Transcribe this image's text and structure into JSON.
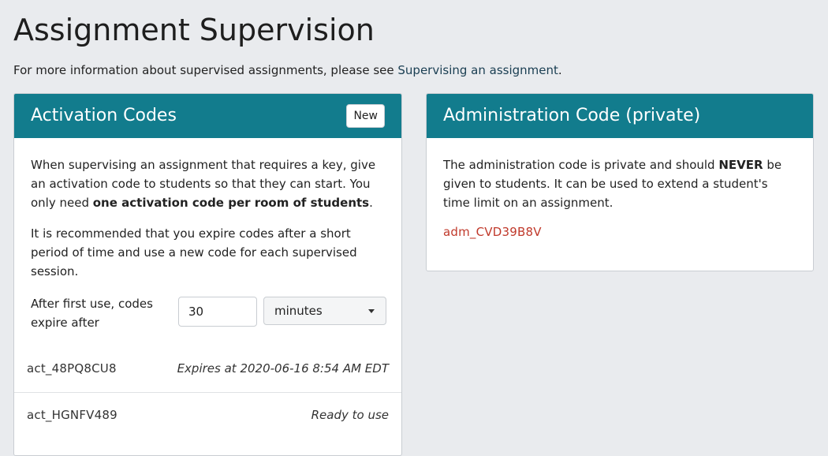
{
  "page": {
    "title": "Assignment Supervision",
    "intro_text": "For more information about supervised assignments, please see ",
    "intro_link": "Supervising an assignment",
    "intro_end": "."
  },
  "activation": {
    "title": "Activation Codes",
    "new_label": "New",
    "para1_a": "When supervising an assignment that requires a key, give an activation code to students so that they can start. You only need ",
    "para1_bold": "one activation code per room of students",
    "para1_b": ".",
    "para2": "It is recommended that you expire codes after a short period of time and use a new code for each supervised session.",
    "expire_label": "After first use, codes expire after",
    "expire_value": "30",
    "expire_unit": "minutes",
    "codes": [
      {
        "code": "act_48PQ8CU8",
        "status": "Expires at 2020-06-16 8:54 AM EDT"
      },
      {
        "code": "act_HGNFV489",
        "status": "Ready to use"
      }
    ]
  },
  "administration": {
    "title": "Administration Code (private)",
    "text_a": "The administration code is private and should ",
    "text_bold": "NEVER",
    "text_b": " be given to students. It can be used to extend a student's time limit on an assignment.",
    "code": "adm_CVD39B8V"
  },
  "colors": {
    "header_bg": "#127c8d",
    "page_bg": "#e9ebee",
    "admin_code": "#c0392b"
  }
}
